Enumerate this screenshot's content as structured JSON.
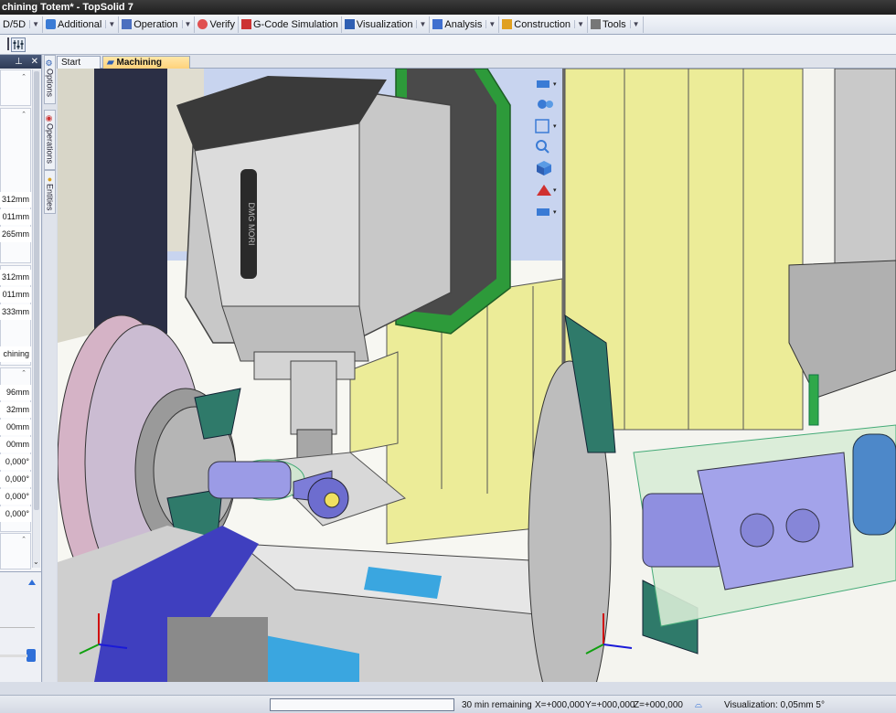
{
  "window": {
    "title": "chining Totem* - TopSolid 7"
  },
  "ribbon": {
    "tabs": [
      {
        "label": "D/5D"
      },
      {
        "label": "Additional"
      },
      {
        "label": "Operation"
      },
      {
        "label": "Verify"
      },
      {
        "label": "G-Code Simulation"
      },
      {
        "label": "Visualization"
      },
      {
        "label": "Analysis"
      },
      {
        "label": "Construction"
      },
      {
        "label": "Tools"
      }
    ]
  },
  "left_panel": {
    "values": [
      "312mm",
      "011mm",
      "265mm",
      "312mm",
      "011mm",
      "333mm",
      "chining",
      "96mm",
      "32mm",
      "00mm",
      "00mm",
      "0,000°",
      "0,000°",
      "0,000°",
      "0,000°"
    ]
  },
  "side_tabs": {
    "options": "Options",
    "operations": "Operations",
    "entities": "Entities"
  },
  "doc_tabs": {
    "start": "Start Page",
    "active": "Machining Totem*"
  },
  "viewport": {
    "machine_label": "DMG MORI"
  },
  "status": {
    "remaining": "30 min remaining",
    "x": "X=+000,000",
    "y": "Y=+000,000",
    "z": "Z=+000,000",
    "visualization": "Visualization: 0,05mm 5°"
  },
  "colors": {
    "ribbon_accent": "#2f5fb3",
    "active_tab": "#ffd27a",
    "machine_green": "#2fa84a",
    "part_purple": "#8f8fe0"
  }
}
